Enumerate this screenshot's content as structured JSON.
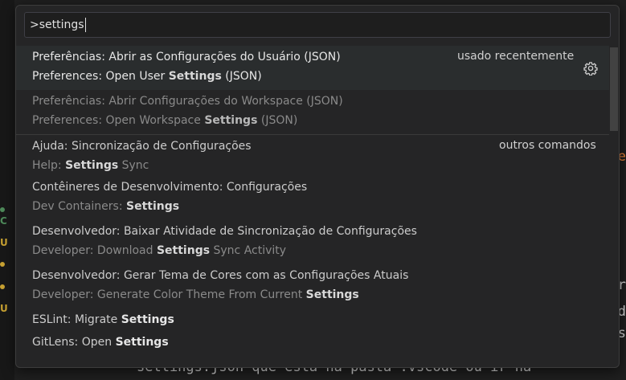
{
  "search": {
    "value": ">settings"
  },
  "items": [
    {
      "line1": "Preferências: Abrir as Configurações do Usuário (JSON)",
      "line2_pre": "Preferences: Open User ",
      "line2_em": "Settings",
      "line2_post": " (JSON)",
      "tag": "usado recentemente"
    },
    {
      "line1": "Preferências: Abrir Configurações do Workspace (JSON)",
      "line2_pre": "Preferences: Open Workspace ",
      "line2_em": "Settings",
      "line2_post": " (JSON)"
    },
    {
      "line1": "Ajuda: Sincronização de Configurações",
      "line2_pre": "Help: ",
      "line2_em": "Settings",
      "line2_post": " Sync",
      "tag": "outros comandos"
    },
    {
      "line1": "Contêineres de Desenvolvimento: Configurações",
      "line2_pre": "Dev Containers: ",
      "line2_em": "Settings",
      "line2_post": ""
    },
    {
      "line1": "Desenvolvedor: Baixar Atividade de Sincronização de Configurações",
      "line2_pre": "Developer: Download ",
      "line2_em": "Settings",
      "line2_post": " Sync Activity"
    },
    {
      "line1": "Desenvolvedor: Gerar Tema de Cores com as Configurações Atuais",
      "line2_pre": "Developer: Generate Color Theme From Current ",
      "line2_em": "Settings",
      "line2_post": ""
    },
    {
      "line1_pre": "ESLint: Migrate ",
      "line1_em": "Settings"
    },
    {
      "line1_pre": "GitLens: Open ",
      "line1_em": "Settings"
    }
  ],
  "background": {
    "bottom_text": "settings.json que está na pasta .vscode ou ir na"
  },
  "colors": {
    "accent_orange": "#e8823a",
    "gutter_green": "#4e8a5a",
    "gutter_yellow": "#c8a232"
  }
}
